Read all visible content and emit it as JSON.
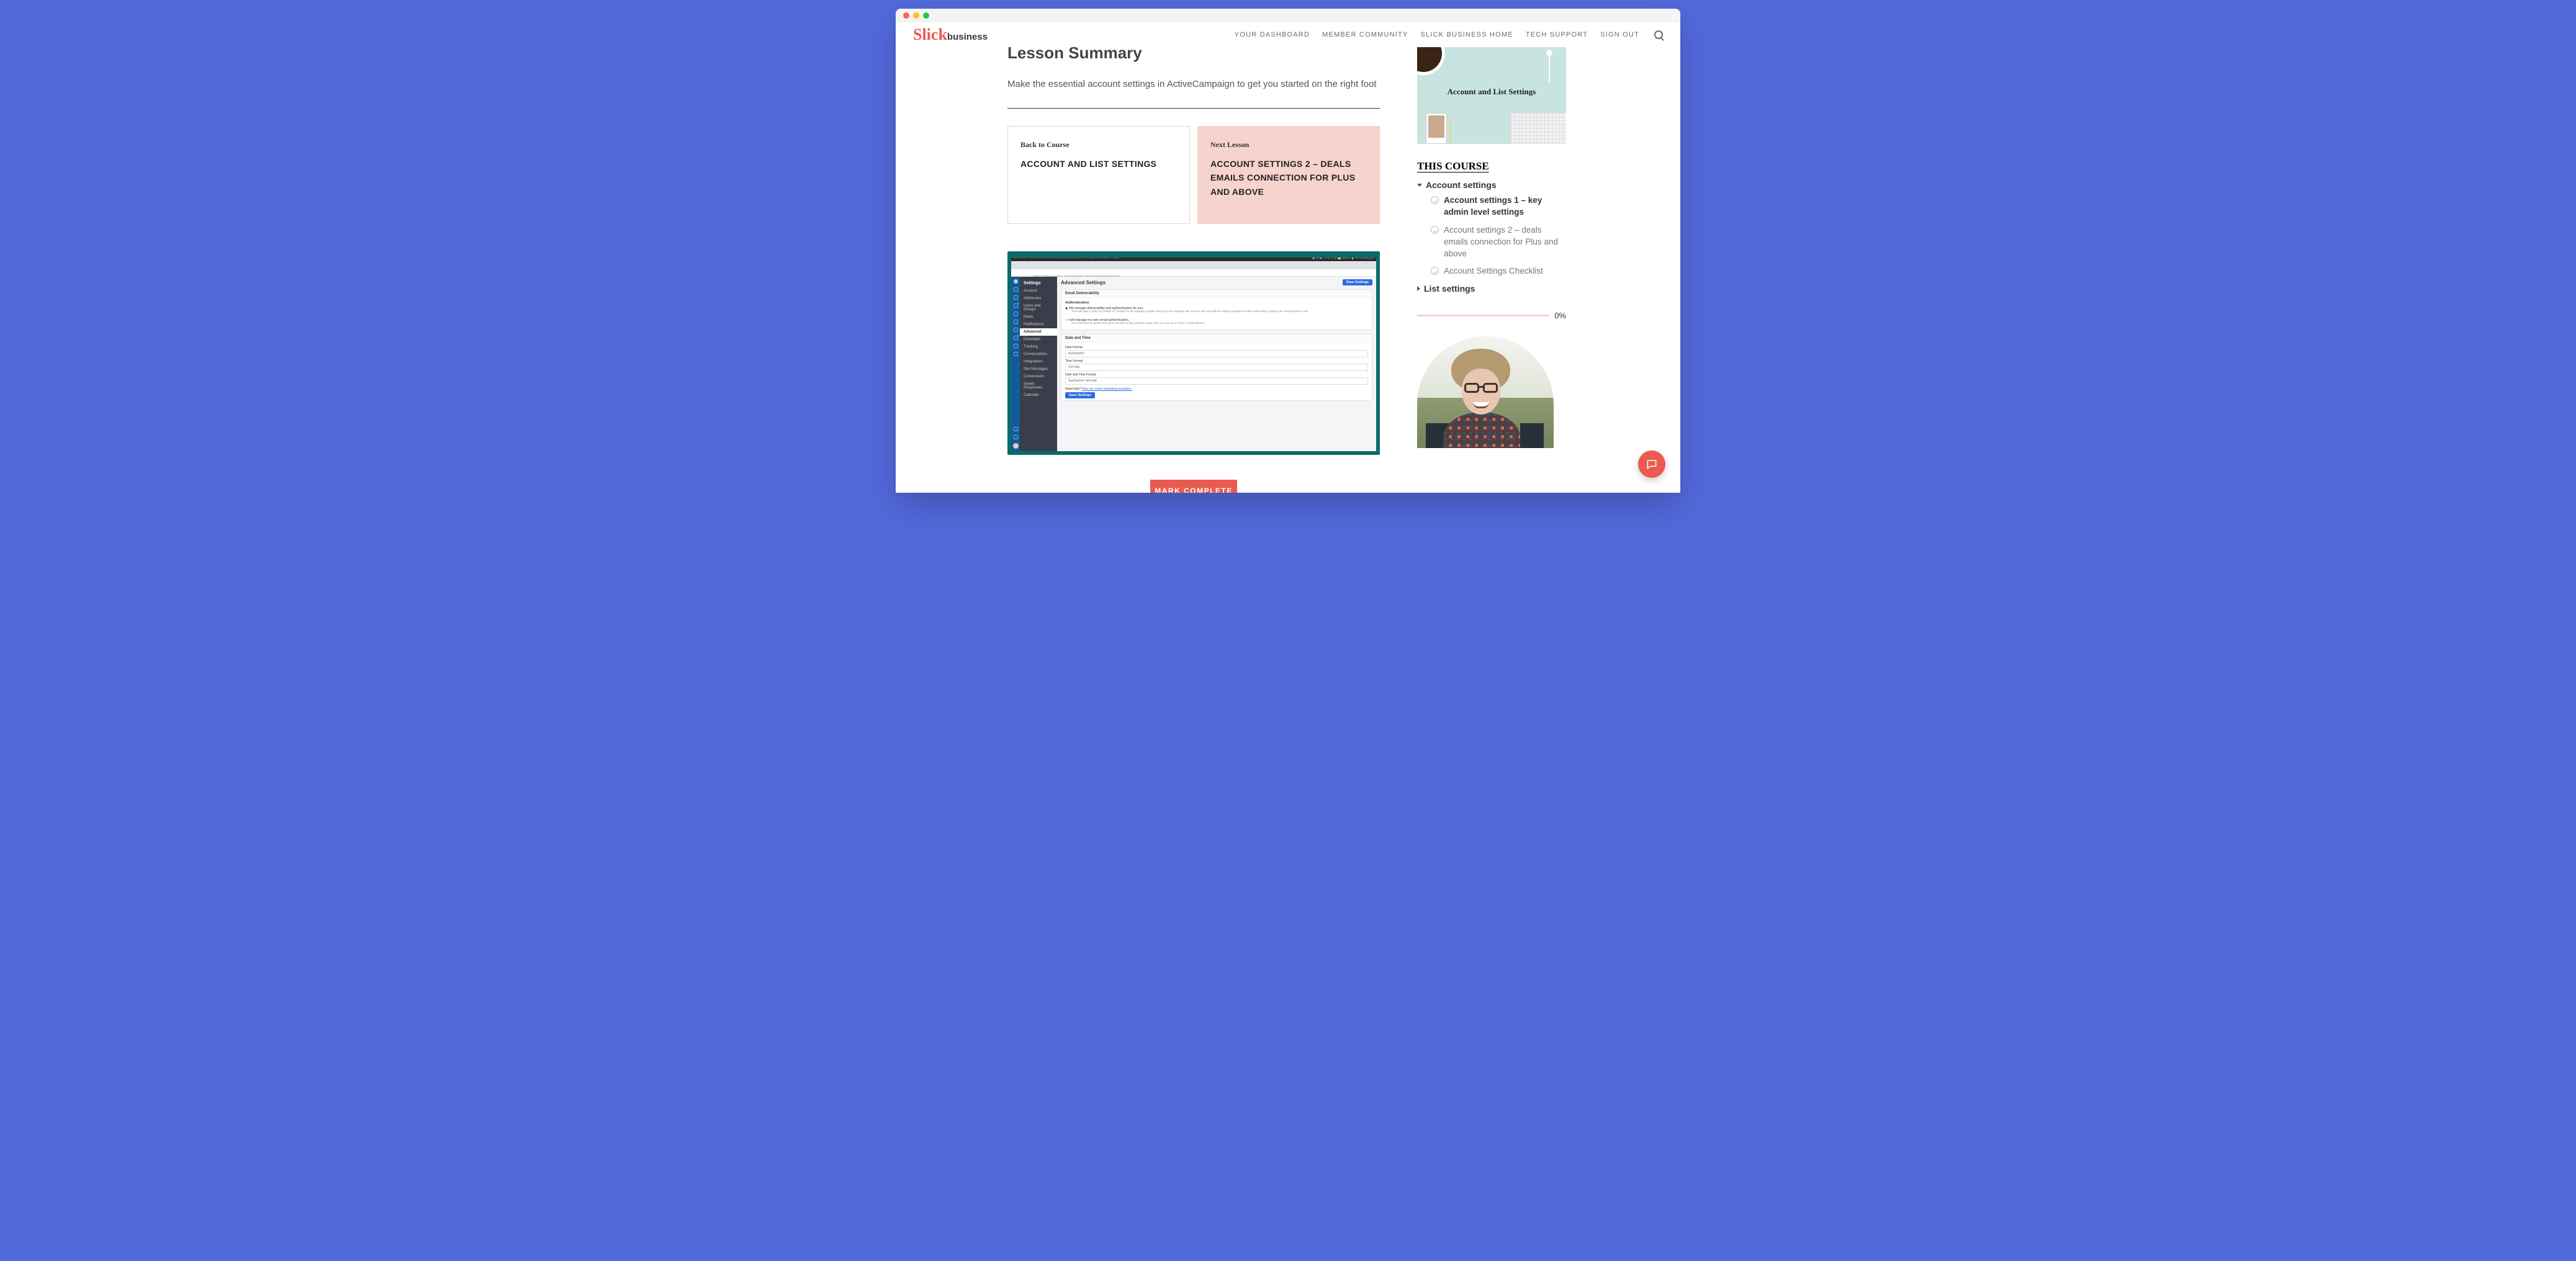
{
  "logo_script": "Slick",
  "logo_word": "business",
  "nav": [
    "YOUR DASHBOARD",
    "MEMBER COMMUNITY",
    "SLICK BUSINESS HOME",
    "TECH SUPPORT",
    "SIGN OUT"
  ],
  "h1": "Lesson Summary",
  "summary": "Make the essential account settings in ActiveCampaign to get you started on the right foot",
  "card_back_sub": "Back to Course",
  "card_back_ttl": "ACCOUNT AND LIST SETTINGS",
  "card_next_sub": "Next Lesson",
  "card_next_ttl": "ACCOUNT SETTINGS 2 – DEALS EMAILS CONNECTION FOR PLUS AND ABOVE",
  "shot": {
    "menubar": "Chrome  File  Edit  View  History  Bookmarks  People  Window  Help",
    "menubar_right": "▦ ✉ ⏏ ⇪ ⦿ ♫ ⚙ 📶  100%  🔋  Fri 11:44  Q  ≡",
    "url": "https://slickersandbox.activehosted.com/app/settings/advanced",
    "side_h": "Settings",
    "side": [
      "Account",
      "Addresses",
      "Users and Groups",
      "Deals",
      "Notifications",
      "Advanced",
      "Developer",
      "Tracking",
      "Conversations",
      "Integrations",
      "Site Messages",
      "Conversions",
      "Saved Responses",
      "Calendar"
    ],
    "active_side": "Advanced",
    "title": "Advanced Settings",
    "save": "Save Settings",
    "p1": "Email Deliverability",
    "auth": "Authentication",
    "r1": "We manage deliverability and authentication for you.",
    "r1d": "This will add a \"Sent on behalf of\" header to all outgoing emails. Most of your contacts will not see this and will be entirely unaware of this unless they inspect the email source code.",
    "r2": "I will manage my own email authentication.",
    "r2d": "You will need to update the DNS records of any domain name that you use as a \"from\" email address.",
    "p2": "Date and Time",
    "df": "Date Format",
    "dfv": "%m/%d/%Y",
    "tf": "Time Format",
    "tfv": "%H:%M",
    "dtf": "Date and Time Format",
    "dtfv": "%m/%d/%Y %H:%M",
    "help": "Need help? ",
    "help_link": "Here are some formatting examples."
  },
  "mark": "MARK COMPLETE",
  "thumb_text": "Account and List Settings",
  "this_course": "THIS COURSE",
  "section1": "Account settings",
  "lessons1": [
    "Account settings 1 – key admin level settings",
    "Account settings 2 – deals emails connection for Plus and above",
    "Account Settings Checklist"
  ],
  "section2": "List settings",
  "progress": "0%"
}
